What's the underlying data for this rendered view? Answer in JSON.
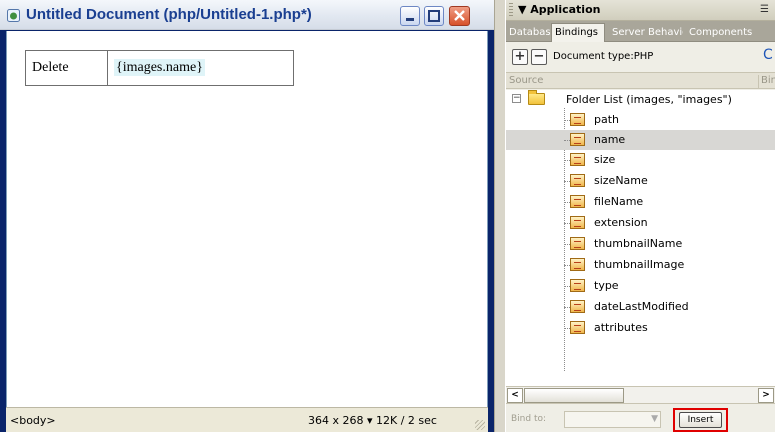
{
  "document_window": {
    "title": "Untitled Document (php/Untitled-1.php*)",
    "table": {
      "cell_1": "Delete",
      "cell_2": "{images.name}"
    },
    "status_bar": {
      "tag": "<body>",
      "size_info": "364 x 268 ▾ 12K / 2 sec"
    }
  },
  "application_panel": {
    "title": "▼ Application",
    "tabs": [
      {
        "label": "Databases"
      },
      {
        "label": "Bindings",
        "active": true
      },
      {
        "label": "Server Behaviors"
      },
      {
        "label": "Components"
      }
    ],
    "toolbar": {
      "add_label": "+",
      "remove_label": "−",
      "document_type": "Document type:PHP"
    },
    "columns": {
      "source": "Source",
      "binding": "Binding"
    },
    "tree": {
      "root": "Folder List (images, \"images\")",
      "fields": [
        {
          "label": "path"
        },
        {
          "label": "name",
          "selected": true
        },
        {
          "label": "size"
        },
        {
          "label": "sizeName"
        },
        {
          "label": "fileName"
        },
        {
          "label": "extension"
        },
        {
          "label": "thumbnailName"
        },
        {
          "label": "thumbnailImage"
        },
        {
          "label": "type"
        },
        {
          "label": "dateLastModified"
        },
        {
          "label": "attributes"
        }
      ]
    },
    "bottom_bar": {
      "bind_to_label": "Bind to:",
      "bind_to_value": "",
      "insert_label": "Insert"
    }
  },
  "colors": {
    "title_text": "#1a3f91",
    "selected_row": "#d8d7d4",
    "highlight_border": "#e00000",
    "dynamic_text_bg": "#dff4f8"
  }
}
